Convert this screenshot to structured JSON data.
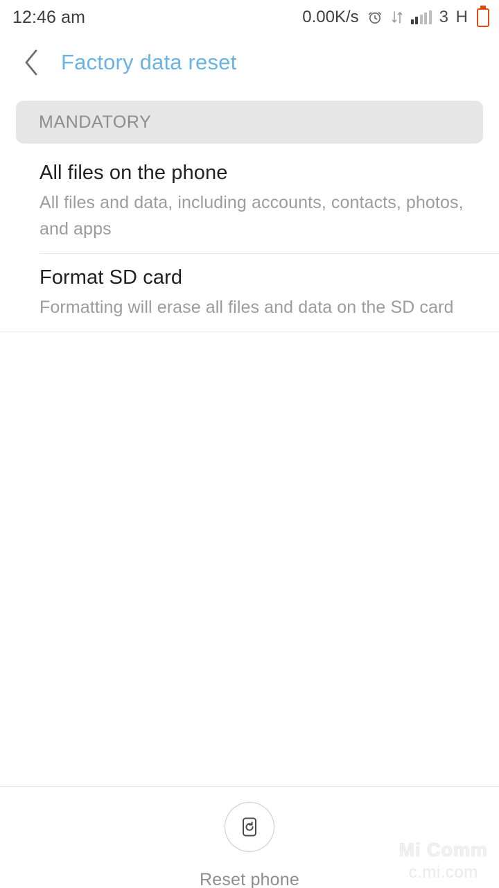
{
  "status_bar": {
    "time": "12:46 am",
    "network_speed": "0.00K/s",
    "alarm_icon": "alarm-clock-icon",
    "data_transfer_icon": "data-transfer-arrows-icon",
    "signal_icon": "signal-bars-icon",
    "network_type": "3 H",
    "battery_icon": "battery-empty-icon",
    "battery_color": "#e04a10"
  },
  "header": {
    "back_icon": "chevron-left-icon",
    "title": "Factory data reset",
    "title_color": "#6cb3e5"
  },
  "section": {
    "label": "MANDATORY",
    "background": "#e6e6e6"
  },
  "list": {
    "items": [
      {
        "title": "All files on the phone",
        "subtitle": "All files and data, including accounts, contacts, photos, and apps"
      },
      {
        "title": "Format SD card",
        "subtitle": "Formatting will erase all files and data on the SD card"
      }
    ]
  },
  "bottom_action": {
    "icon": "reset-phone-icon",
    "label": "Reset phone"
  },
  "watermark": {
    "title": "Mi Comm",
    "url": "c.mi.com"
  }
}
